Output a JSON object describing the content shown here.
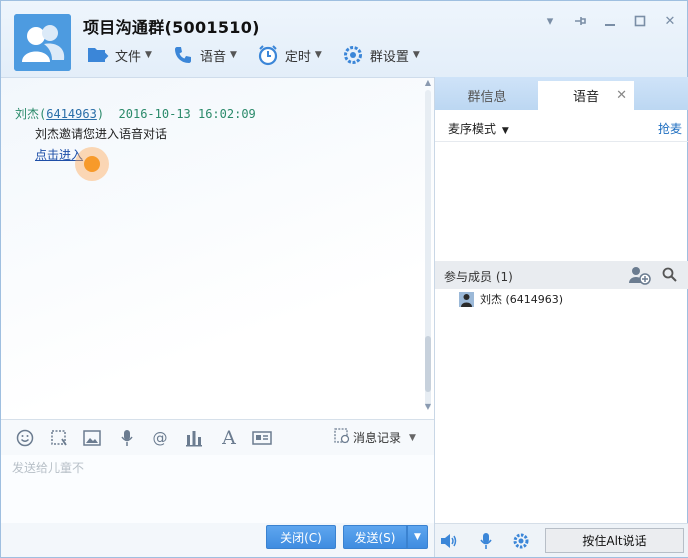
{
  "window": {
    "title": "项目沟通群(5001510)"
  },
  "toolbar": {
    "file": "文件",
    "voice": "语音",
    "timer": "定时",
    "group_settings": "群设置"
  },
  "chat": {
    "sender_name": "刘杰",
    "sender_id": "6414963",
    "timestamp": "2016-10-13 16:02:09",
    "message": "刘杰邀请您进入语音对话",
    "link": "点击进入"
  },
  "input": {
    "history_label": "消息记录",
    "placeholder": "发送给儿童不"
  },
  "buttons": {
    "close": "关闭(C)",
    "send": "发送(S)"
  },
  "right_panel": {
    "tabs": [
      {
        "label": "群信息"
      },
      {
        "label": "语音"
      }
    ],
    "mode": "麦序模式",
    "grab_mic": "抢麦",
    "members_header": "参与成员 (1)",
    "member": "刘杰 (6414963)",
    "push_to_talk": "按住Alt说话"
  },
  "icons": {
    "avatar": "group-avatar-icon",
    "accent": "#3f8ce0"
  }
}
